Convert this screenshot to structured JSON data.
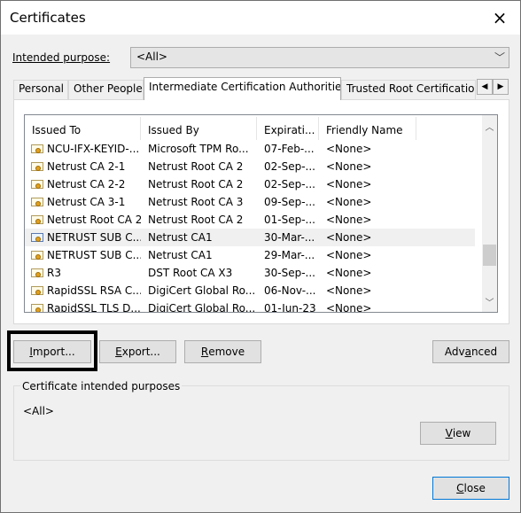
{
  "window": {
    "title": "Certificates"
  },
  "purpose": {
    "label": "Intended purpose:",
    "value": "<All>"
  },
  "tabs": [
    "Personal",
    "Other People",
    "Intermediate Certification Authorities",
    "Trusted Root Certification"
  ],
  "active_tab_index": 2,
  "columns": [
    "Issued To",
    "Issued By",
    "Expirati...",
    "Friendly Name"
  ],
  "rows": [
    {
      "issued_to": "NCU-IFX-KEYID-...",
      "issued_by": "Microsoft TPM Ro...",
      "expiration": "07-Feb-...",
      "friendly": "<None>"
    },
    {
      "issued_to": "Netrust CA 2-1",
      "issued_by": "Netrust Root CA 2",
      "expiration": "02-Sep-...",
      "friendly": "<None>"
    },
    {
      "issued_to": "Netrust CA 2-2",
      "issued_by": "Netrust Root CA 2",
      "expiration": "02-Sep-...",
      "friendly": "<None>"
    },
    {
      "issued_to": "Netrust CA 3-1",
      "issued_by": "Netrust Root CA 3",
      "expiration": "09-Sep-...",
      "friendly": "<None>"
    },
    {
      "issued_to": "Netrust Root CA 2",
      "issued_by": "Netrust Root CA 2",
      "expiration": "01-Sep-...",
      "friendly": "<None>"
    },
    {
      "issued_to": "NETRUST SUB C...",
      "issued_by": "Netrust CA1",
      "expiration": "30-Mar-...",
      "friendly": "<None>"
    },
    {
      "issued_to": "NETRUST SUB C...",
      "issued_by": "Netrust CA1",
      "expiration": "29-Mar-...",
      "friendly": "<None>"
    },
    {
      "issued_to": "R3",
      "issued_by": "DST Root CA X3",
      "expiration": "30-Sep-...",
      "friendly": "<None>"
    },
    {
      "issued_to": "RapidSSL RSA C...",
      "issued_by": "DigiCert Global Ro...",
      "expiration": "06-Nov-...",
      "friendly": "<None>"
    },
    {
      "issued_to": "RapidSSL TLS D...",
      "issued_by": "DigiCert Global Ro...",
      "expiration": "01-Jun-23",
      "friendly": "<None>"
    }
  ],
  "selected_row_index": 5,
  "buttons": {
    "import": {
      "accel": "I",
      "rest": "mport..."
    },
    "export": {
      "accel": "E",
      "rest": "xport..."
    },
    "remove": {
      "accel": "R",
      "rest": "emove"
    },
    "advanced": {
      "pre": "Adv",
      "accel": "a",
      "rest": "nced"
    },
    "view": {
      "accel": "V",
      "rest": "iew"
    },
    "close": {
      "accel": "C",
      "rest": "lose"
    }
  },
  "purposes_group": {
    "title": "Certificate intended purposes",
    "value": "<All>"
  },
  "icons": {
    "close": "×",
    "dropdown": "﹀",
    "tab_left": "◀",
    "tab_right": "▶",
    "scroll_up": "︿",
    "scroll_down": "﹀"
  },
  "colors": {
    "highlight_box": "#000000",
    "focus_border": "#0078d7"
  }
}
